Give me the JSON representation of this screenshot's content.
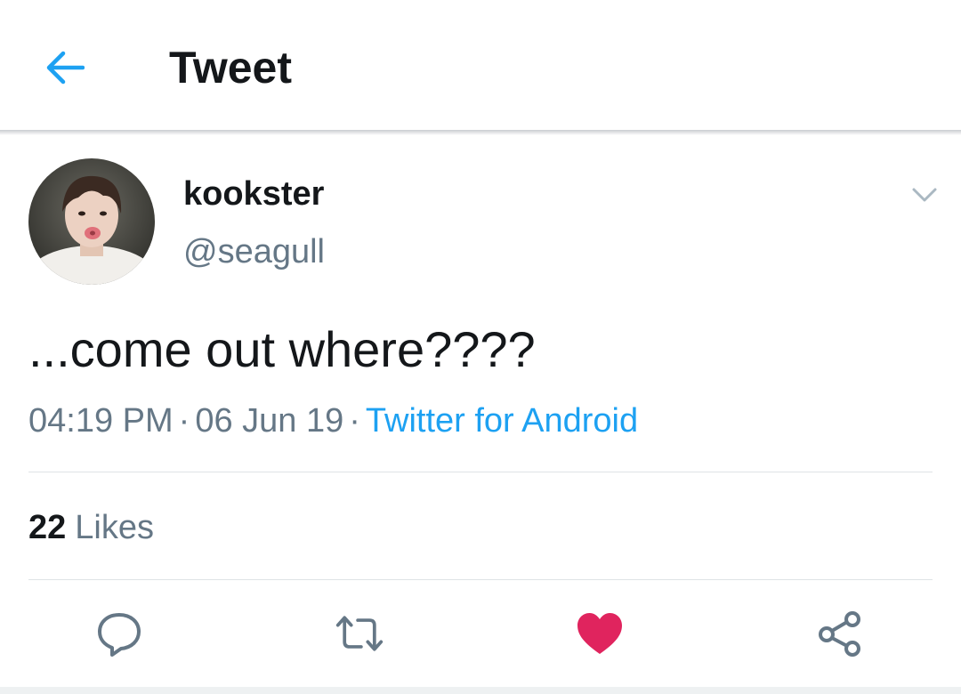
{
  "header": {
    "title": "Tweet",
    "back_icon": "arrow-left-icon"
  },
  "tweet": {
    "author": {
      "display_name": "kookster",
      "handle": "@seagull",
      "avatar_icon": "user-avatar-photo"
    },
    "text": "...come out where????",
    "time": "04:19 PM",
    "separator": "·",
    "date": "06 Jun 19",
    "source": "Twitter for Android",
    "likes": {
      "count": "22",
      "label": "Likes"
    },
    "liked": true
  },
  "actions": [
    {
      "name": "reply",
      "icon": "comment-icon"
    },
    {
      "name": "retweet",
      "icon": "retweet-icon"
    },
    {
      "name": "like",
      "icon": "heart-icon"
    },
    {
      "name": "share",
      "icon": "share-icon"
    }
  ],
  "colors": {
    "accent": "#1da1f2",
    "like": "#e0245e",
    "secondary_text": "#657786",
    "primary_text": "#14171a",
    "icon_gray": "#657786"
  }
}
